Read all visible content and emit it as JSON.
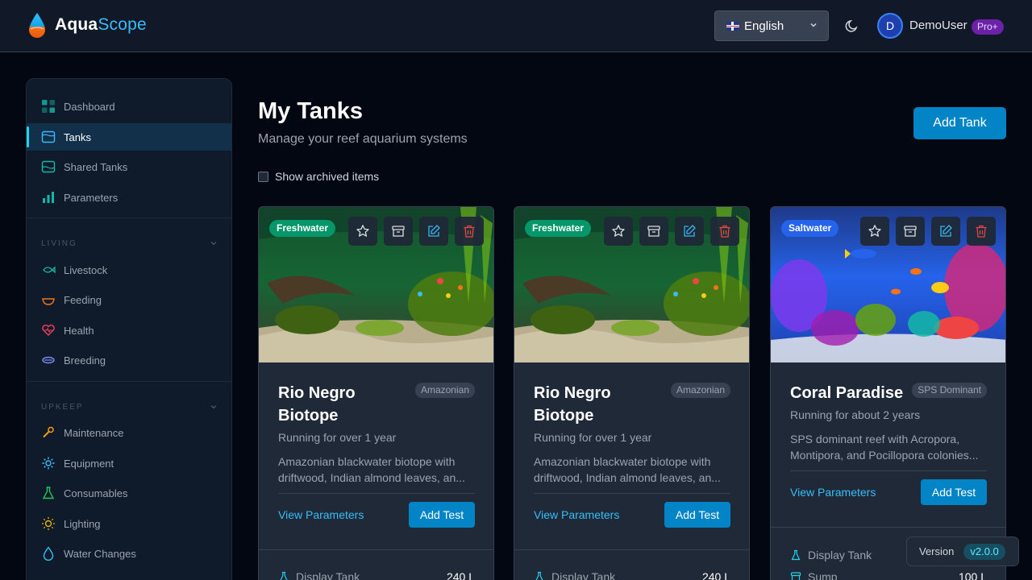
{
  "brand": {
    "name_part1": "Aqua",
    "name_part2": "Scope"
  },
  "header": {
    "language": "English",
    "user": {
      "initial": "D",
      "name": "DemoUser",
      "plan_badge": "Pro+"
    }
  },
  "sidebar": {
    "main_items": [
      {
        "label": "Dashboard",
        "icon": "grid-icon"
      },
      {
        "label": "Tanks",
        "icon": "tank-icon",
        "active": true
      },
      {
        "label": "Shared Tanks",
        "icon": "shared-tank-icon"
      },
      {
        "label": "Parameters",
        "icon": "bar-chart-icon"
      }
    ],
    "living_section": {
      "title": "LIVING",
      "items": [
        {
          "label": "Livestock",
          "icon": "fish-icon"
        },
        {
          "label": "Feeding",
          "icon": "bowl-icon"
        },
        {
          "label": "Health",
          "icon": "heart-pulse-icon"
        },
        {
          "label": "Breeding",
          "icon": "eggs-icon"
        }
      ]
    },
    "upkeep_section": {
      "title": "UPKEEP",
      "items": [
        {
          "label": "Maintenance",
          "icon": "wrench-icon"
        },
        {
          "label": "Equipment",
          "icon": "cog-icon"
        },
        {
          "label": "Consumables",
          "icon": "flask-icon"
        },
        {
          "label": "Lighting",
          "icon": "sun-icon"
        },
        {
          "label": "Water Changes",
          "icon": "droplet-icon"
        }
      ]
    }
  },
  "page": {
    "title": "My Tanks",
    "subtitle": "Manage your reef aquarium systems",
    "add_button": "Add Tank",
    "show_archived_label": "Show archived items"
  },
  "tanks": [
    {
      "type": "Freshwater",
      "name_line1": "Rio Negro",
      "name_line2": "Biotope",
      "style": "Amazonian",
      "running": "Running for over 1 year",
      "desc_line1": "Amazonian blackwater biotope with",
      "desc_line2": "driftwood, Indian almond leaves, an...",
      "view_params": "View Parameters",
      "add_test": "Add Test",
      "spec_label": "Display Tank",
      "spec_value": "240 L"
    },
    {
      "type": "Freshwater",
      "name_line1": "Rio Negro",
      "name_line2": "Biotope",
      "style": "Amazonian",
      "running": "Running for over 1 year",
      "desc_line1": "Amazonian blackwater biotope with",
      "desc_line2": "driftwood, Indian almond leaves, an...",
      "view_params": "View Parameters",
      "add_test": "Add Test",
      "spec_label": "Display Tank",
      "spec_value": "240 L"
    },
    {
      "type": "Saltwater",
      "name_line1": "Coral Paradise",
      "style": "SPS Dominant",
      "running": "Running for about 2 years",
      "desc_line1": "SPS dominant reef with Acropora,",
      "desc_line2": "Montipora, and Pocillopora colonies...",
      "view_params": "View Parameters",
      "add_test": "Add Test",
      "spec_label": "Display Tank",
      "spec2_label": "Sump",
      "spec2_value": "100 L"
    }
  ],
  "version": {
    "label": "Version",
    "value": "v2.0.0"
  },
  "colors": {
    "accent": "#0284c7",
    "link": "#38bdf8",
    "freshwater": "#059669",
    "saltwater": "#2563eb",
    "pro": "#6b21a8"
  }
}
